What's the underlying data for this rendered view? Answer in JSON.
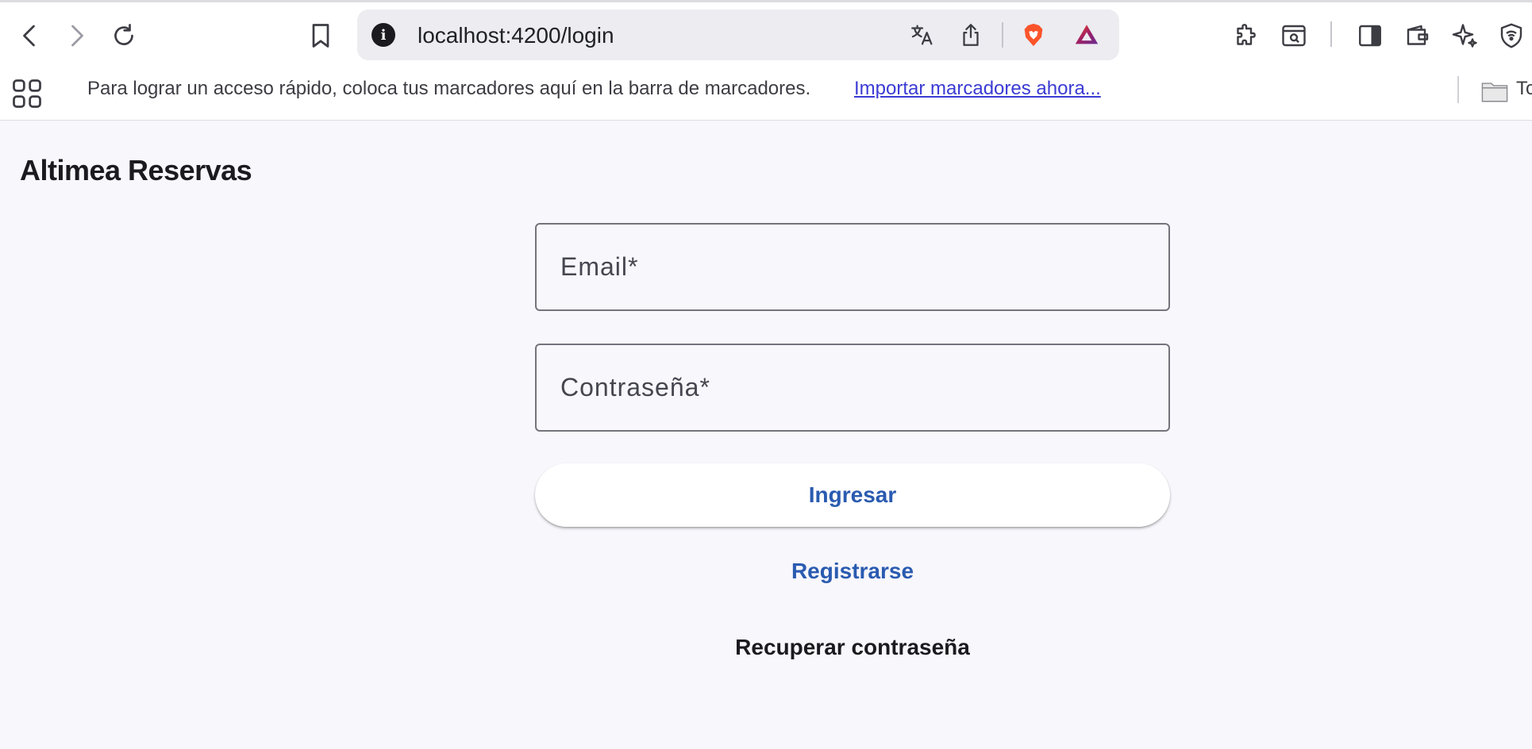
{
  "browser": {
    "url": "localhost:4200/login",
    "bookmarks_bar": {
      "message": "Para lograr un acceso rápido, coloca tus marcadores aquí en la barra de marcadores.",
      "import_link": "Importar marcadores ahora...",
      "folder_label": "To"
    },
    "toolbar_icons": [
      "back-icon",
      "forward-icon",
      "reload-icon",
      "bookmark-icon",
      "site-info-icon",
      "translate-icon",
      "share-icon",
      "brave-shields-icon",
      "brave-rewards-icon",
      "extensions-icon",
      "tab-search-icon",
      "sidebar-icon",
      "wallet-icon",
      "leo-ai-icon",
      "vpn-icon"
    ]
  },
  "page": {
    "title": "Altimea Reservas",
    "form": {
      "email_placeholder": "Email*",
      "password_placeholder": "Contraseña*",
      "login_label": "Ingresar",
      "register_label": "Registrarse",
      "recover_label": "Recuperar contraseña"
    }
  },
  "colors": {
    "page_background": "#f8f7fc",
    "primary": "#2a5bb0",
    "field_border": "#74747c",
    "brave_orange": "#fb542b"
  }
}
